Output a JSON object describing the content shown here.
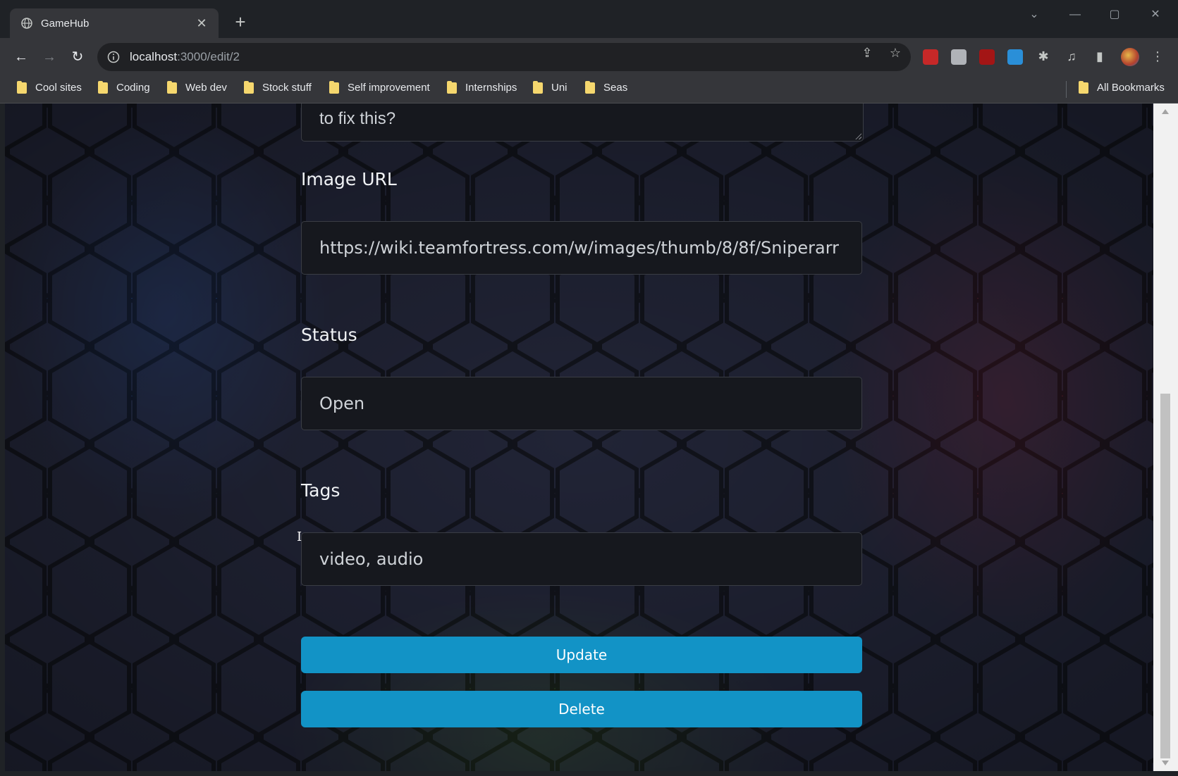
{
  "browser": {
    "tab_title": "GameHub",
    "url_host": "localhost",
    "url_path": ":3000/edit/2",
    "bookmarks": [
      "Cool sites",
      "Coding",
      "Web dev",
      "Stock stuff",
      "Self improvement",
      "Internships",
      "Uni",
      "Seas"
    ],
    "all_bookmarks": "All Bookmarks"
  },
  "form": {
    "description_tail": "to fix this?",
    "image_url_label": "Image URL",
    "image_url_value": "https://wiki.teamfortress.com/w/images/thumb/8/8f/Sniperarr",
    "status_label": "Status",
    "status_value": "Open",
    "tags_label": "Tags",
    "tags_value": "video, audio",
    "update_label": "Update",
    "delete_label": "Delete"
  },
  "colors": {
    "button": "#1293c6",
    "glow_blue": "#2878ff",
    "glow_red": "#ff2846",
    "glow_green": "#78e628"
  }
}
